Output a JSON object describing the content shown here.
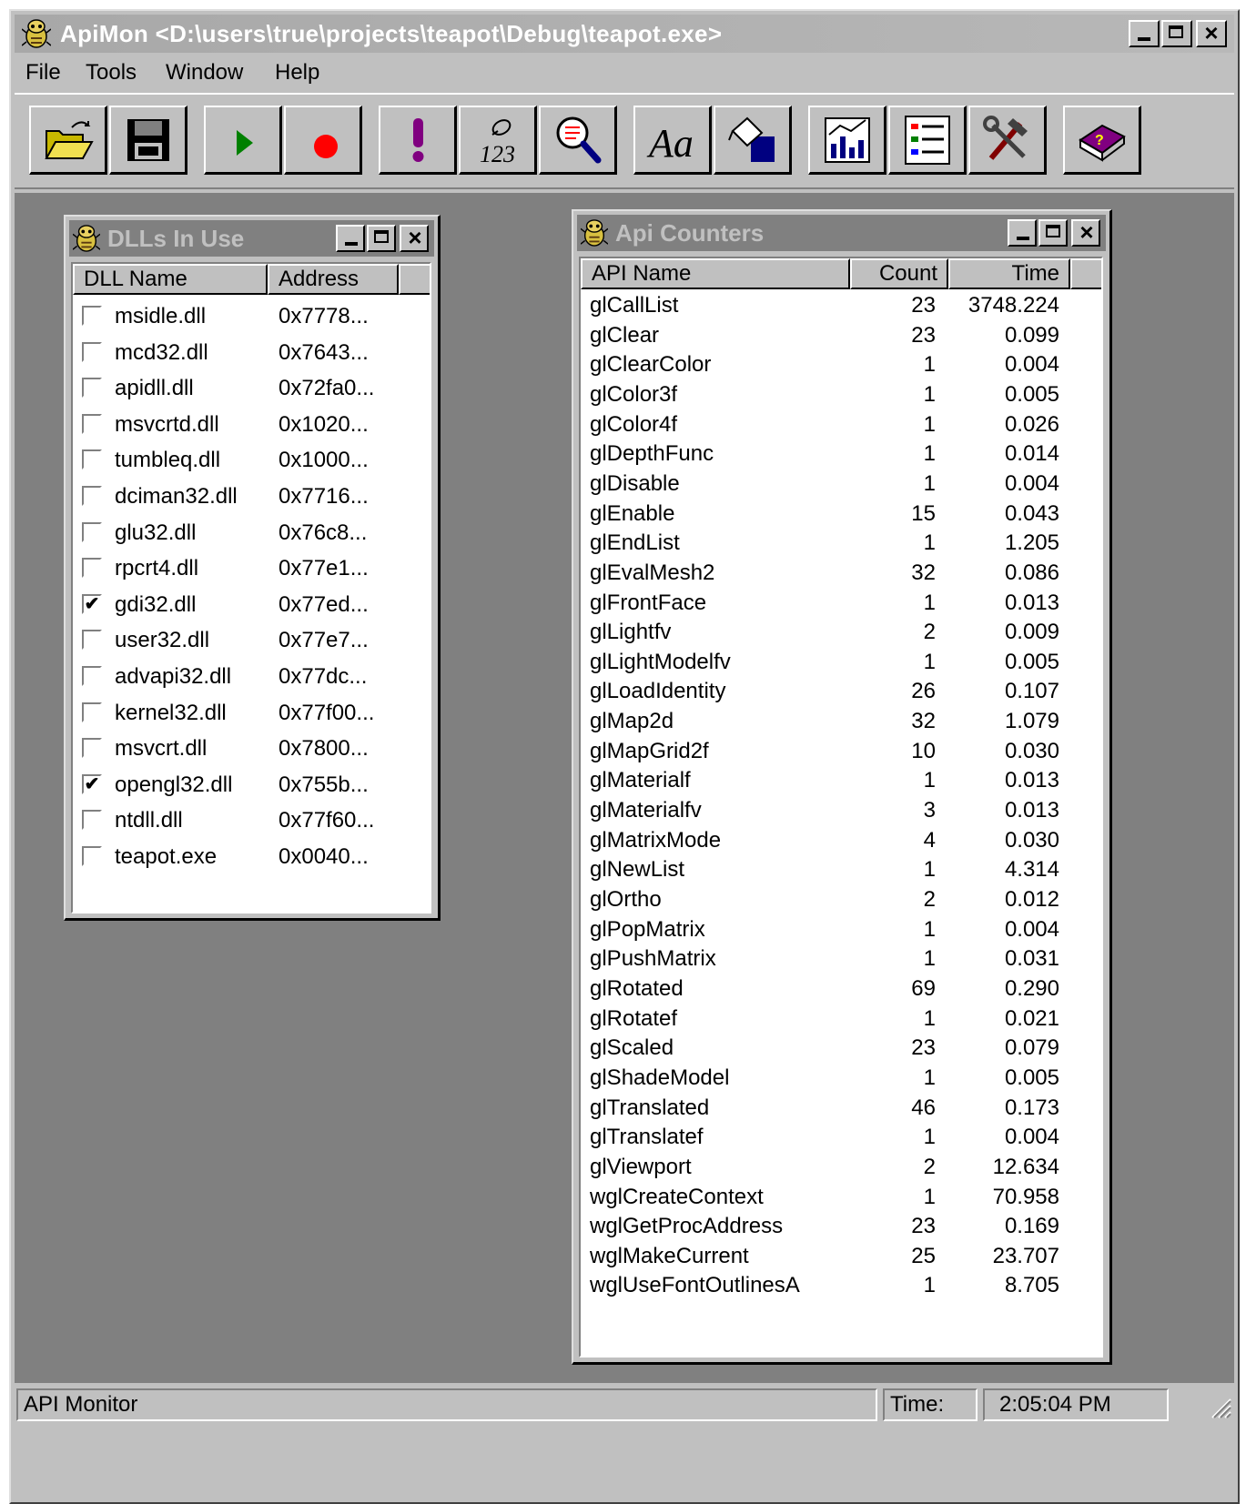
{
  "window": {
    "title": "ApiMon <D:\\users\\true\\projects\\teapot\\Debug\\teapot.exe>"
  },
  "menu": [
    "File",
    "Tools",
    "Window",
    "Help"
  ],
  "toolbar": [
    {
      "icon": "open-folder-icon"
    },
    {
      "icon": "save-disk-icon"
    },
    {
      "icon": "play-icon",
      "color": "#008000"
    },
    {
      "icon": "record-icon",
      "color": "#ff0000"
    },
    {
      "icon": "exclamation-icon",
      "color": "#800080"
    },
    {
      "icon": "counter-icon"
    },
    {
      "icon": "magnifier-icon"
    },
    {
      "icon": "font-icon"
    },
    {
      "icon": "paint-bucket-icon"
    },
    {
      "icon": "graph-icon"
    },
    {
      "icon": "list-icon"
    },
    {
      "icon": "tools-icon"
    },
    {
      "icon": "help-book-icon"
    }
  ],
  "dll_window": {
    "title": "DLLs In Use",
    "columns": [
      "DLL Name",
      "Address"
    ],
    "rows": [
      {
        "name": "msidle.dll",
        "address": "0x7778...",
        "checked": false
      },
      {
        "name": "mcd32.dll",
        "address": "0x7643...",
        "checked": false
      },
      {
        "name": "apidll.dll",
        "address": "0x72fa0...",
        "checked": false
      },
      {
        "name": "msvcrtd.dll",
        "address": "0x1020...",
        "checked": false
      },
      {
        "name": "tumbleq.dll",
        "address": "0x1000...",
        "checked": false
      },
      {
        "name": "dciman32.dll",
        "address": "0x7716...",
        "checked": false
      },
      {
        "name": "glu32.dll",
        "address": "0x76c8...",
        "checked": false
      },
      {
        "name": "rpcrt4.dll",
        "address": "0x77e1...",
        "checked": false
      },
      {
        "name": "gdi32.dll",
        "address": "0x77ed...",
        "checked": true
      },
      {
        "name": "user32.dll",
        "address": "0x77e7...",
        "checked": false
      },
      {
        "name": "advapi32.dll",
        "address": "0x77dc...",
        "checked": false
      },
      {
        "name": "kernel32.dll",
        "address": "0x77f00...",
        "checked": false
      },
      {
        "name": "msvcrt.dll",
        "address": "0x7800...",
        "checked": false
      },
      {
        "name": "opengl32.dll",
        "address": "0x755b...",
        "checked": true
      },
      {
        "name": "ntdll.dll",
        "address": "0x77f60...",
        "checked": false
      },
      {
        "name": "teapot.exe",
        "address": "0x0040...",
        "checked": false
      }
    ]
  },
  "api_window": {
    "title": "Api Counters",
    "columns": [
      "API Name",
      "Count",
      "Time"
    ],
    "rows": [
      {
        "name": "glCallList",
        "count": "23",
        "time": "3748.224"
      },
      {
        "name": "glClear",
        "count": "23",
        "time": "0.099"
      },
      {
        "name": "glClearColor",
        "count": "1",
        "time": "0.004"
      },
      {
        "name": "glColor3f",
        "count": "1",
        "time": "0.005"
      },
      {
        "name": "glColor4f",
        "count": "1",
        "time": "0.026"
      },
      {
        "name": "glDepthFunc",
        "count": "1",
        "time": "0.014"
      },
      {
        "name": "glDisable",
        "count": "1",
        "time": "0.004"
      },
      {
        "name": "glEnable",
        "count": "15",
        "time": "0.043"
      },
      {
        "name": "glEndList",
        "count": "1",
        "time": "1.205"
      },
      {
        "name": "glEvalMesh2",
        "count": "32",
        "time": "0.086"
      },
      {
        "name": "glFrontFace",
        "count": "1",
        "time": "0.013"
      },
      {
        "name": "glLightfv",
        "count": "2",
        "time": "0.009"
      },
      {
        "name": "glLightModelfv",
        "count": "1",
        "time": "0.005"
      },
      {
        "name": "glLoadIdentity",
        "count": "26",
        "time": "0.107"
      },
      {
        "name": "glMap2d",
        "count": "32",
        "time": "1.079"
      },
      {
        "name": "glMapGrid2f",
        "count": "10",
        "time": "0.030"
      },
      {
        "name": "glMaterialf",
        "count": "1",
        "time": "0.013"
      },
      {
        "name": "glMaterialfv",
        "count": "3",
        "time": "0.013"
      },
      {
        "name": "glMatrixMode",
        "count": "4",
        "time": "0.030"
      },
      {
        "name": "glNewList",
        "count": "1",
        "time": "4.314"
      },
      {
        "name": "glOrtho",
        "count": "2",
        "time": "0.012"
      },
      {
        "name": "glPopMatrix",
        "count": "1",
        "time": "0.004"
      },
      {
        "name": "glPushMatrix",
        "count": "1",
        "time": "0.031"
      },
      {
        "name": "glRotated",
        "count": "69",
        "time": "0.290"
      },
      {
        "name": "glRotatef",
        "count": "1",
        "time": "0.021"
      },
      {
        "name": "glScaled",
        "count": "23",
        "time": "0.079"
      },
      {
        "name": "glShadeModel",
        "count": "1",
        "time": "0.005"
      },
      {
        "name": "glTranslated",
        "count": "46",
        "time": "0.173"
      },
      {
        "name": "glTranslatef",
        "count": "1",
        "time": "0.004"
      },
      {
        "name": "glViewport",
        "count": "2",
        "time": "12.634"
      },
      {
        "name": "wglCreateContext",
        "count": "1",
        "time": "70.958"
      },
      {
        "name": "wglGetProcAddress",
        "count": "23",
        "time": "0.169"
      },
      {
        "name": "wglMakeCurrent",
        "count": "25",
        "time": "23.707"
      },
      {
        "name": "wglUseFontOutlinesA",
        "count": "1",
        "time": "8.705"
      }
    ]
  },
  "status": {
    "text": "API Monitor",
    "time_label": "Time:",
    "time_value": "2:05:04 PM"
  },
  "colors": {
    "face": "#c0c0c0",
    "mdi_background": "#808080",
    "inactive_caption": "#808080"
  }
}
